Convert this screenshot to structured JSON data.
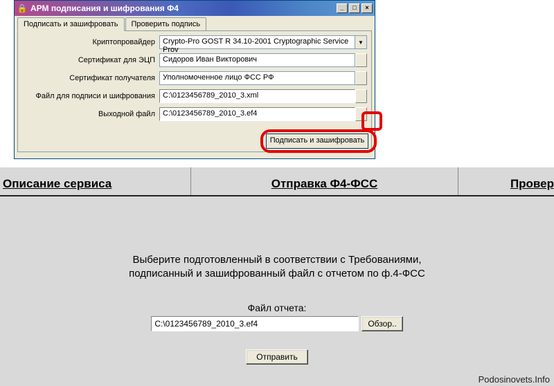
{
  "window": {
    "title": "АРМ  подписания и шифрования Ф4",
    "buttons": {
      "min": "_",
      "max": "□",
      "close": "×"
    },
    "tabs": {
      "active": "Подписать и зашифровать",
      "second": "Проверить подпись"
    },
    "form": {
      "crypto_label": "Криптопровайдер",
      "crypto_value": "Crypto-Pro GOST R 34.10-2001 Cryptographic Service Prov",
      "cert_ecp_label": "Сертификат для ЭЦП",
      "cert_ecp_value": "Сидоров Иван Викторович",
      "cert_recipient_label": "Сертификат получателя",
      "cert_recipient_value": "Уполномоченное лицо ФСС РФ",
      "sign_file_label": "Файл для подписи и шифрования",
      "sign_file_value": "C:\\0123456789_2010_3.xml",
      "out_file_label": "Выходной файл",
      "out_file_value": "C:\\0123456789_2010_3.ef4",
      "submit": "Подписать и зашифровать"
    }
  },
  "page": {
    "tabs": {
      "desc": "Описание сервиса",
      "send": "Отправка Ф4-ФСС",
      "check": "Провер"
    },
    "instr1": "Выберите подготовленный в соответствии с Требованиями,",
    "instr2": "подписанный и зашифрованный файл с отчетом по ф.4-ФСС",
    "file_label": "Файл отчета:",
    "file_value": "C:\\0123456789_2010_3.ef4",
    "browse": "Обзор..",
    "submit": "Отправить",
    "watermark": "Podosinovets.Info"
  }
}
